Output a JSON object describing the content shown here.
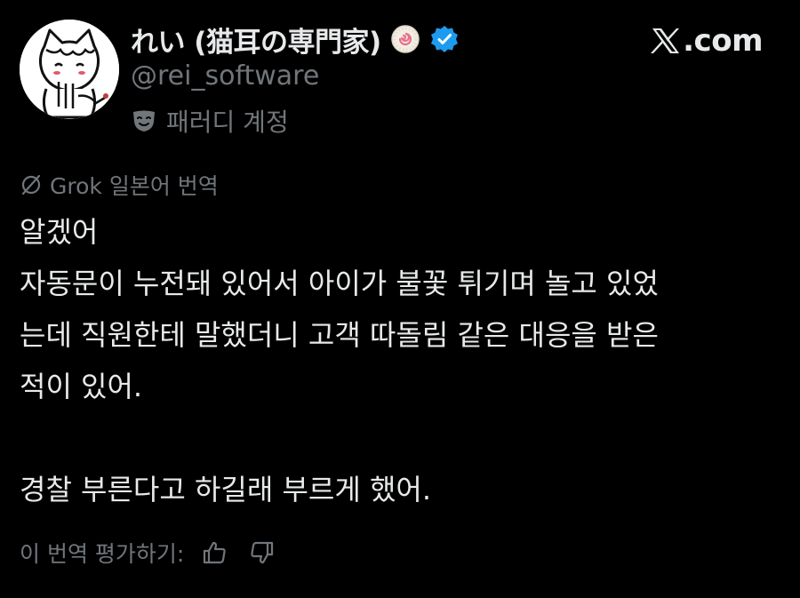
{
  "author": {
    "display_name": "れい (猫耳の専門家)",
    "handle": "@rei_software",
    "parody_label": "패러디 계정",
    "avatar_icon": "cat-ear-avatar",
    "badges": [
      "naruto-badge-icon",
      "verified-check-icon"
    ],
    "verified_color": "#1d9bf0"
  },
  "brand": {
    "logo_icon": "x-logo-icon",
    "text": ".com"
  },
  "translation": {
    "icon": "grok-icon",
    "label": "Grok 일본어 번역"
  },
  "tweet": {
    "lines": [
      "알겠어",
      "자동문이 누전돼 있어서 아이가 불꽃 튀기며 놀고 있었",
      "는데 직원한테 말했더니 고객 따돌림 같은 대응을 받은",
      "적이 있어.",
      "",
      "경찰 부른다고 하길래 부르게 했어."
    ]
  },
  "rating": {
    "label": "이 번역 평가하기:",
    "up_icon": "thumbs-up-icon",
    "down_icon": "thumbs-down-icon"
  },
  "colors": {
    "background": "#000000",
    "primary_text": "#e7e9ea",
    "secondary_text": "#71767b",
    "accent": "#1d9bf0"
  }
}
